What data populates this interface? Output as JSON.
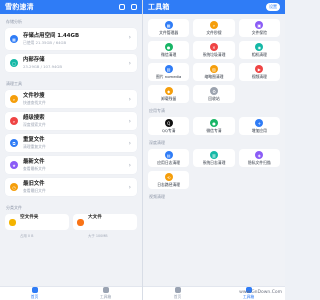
{
  "left": {
    "title": "雪豹速清",
    "sections": {
      "storage": "存储分析",
      "cleanup": "清理工具",
      "categories": "分类文件"
    },
    "storage": {
      "label": "存储占用空间",
      "value": "1.44GB",
      "sub": "已使用 21.35GB / 64GB"
    },
    "internal": {
      "label": "内部存储",
      "sub": "23.29GB / 107.94GB"
    },
    "cleanup_items": [
      {
        "label": "文件秒搜",
        "sub": "快速查找文件"
      },
      {
        "label": "超级搜索",
        "sub": "深度搜索文件"
      },
      {
        "label": "重复文件",
        "sub": "清理重复文件"
      },
      {
        "label": "最新文件",
        "sub": "查看最新文件"
      },
      {
        "label": "最旧文件",
        "sub": "查看最旧文件"
      }
    ],
    "categories": [
      {
        "label": "空文件夹",
        "sub": "占用 0 B"
      },
      {
        "label": "大文件",
        "sub": "大于 100MB"
      }
    ],
    "nav": [
      {
        "label": "首页"
      },
      {
        "label": "工具箱"
      }
    ]
  },
  "right": {
    "title": "工具箱",
    "settings": "设置",
    "tools": [
      {
        "label": "文件管理器"
      },
      {
        "label": "文件秒搜"
      },
      {
        "label": "文件保险"
      },
      {
        "label": "微信清理"
      },
      {
        "label": "系统垃圾清理"
      },
      {
        "label": "相机清理"
      },
      {
        "label": "图片 nomedia"
      },
      {
        "label": "缩略图清理"
      },
      {
        "label": "视频清理"
      },
      {
        "label": "卸载残留"
      },
      {
        "label": "回收站"
      }
    ],
    "sections": {
      "apps": "应用专清",
      "deep": "深度清理",
      "video": "视频清理"
    },
    "apps": [
      {
        "label": "QQ专清"
      },
      {
        "label": "微信专清"
      },
      {
        "label": "增加应用"
      }
    ],
    "deep": [
      {
        "label": "应用日志清理"
      },
      {
        "label": "系统日志清理"
      },
      {
        "label": "隐私文件扫描"
      },
      {
        "label": "日志路径清理"
      }
    ],
    "nav": [
      {
        "label": "首页"
      },
      {
        "label": "工具箱"
      }
    ]
  },
  "watermark": "www.GnDown.Com"
}
